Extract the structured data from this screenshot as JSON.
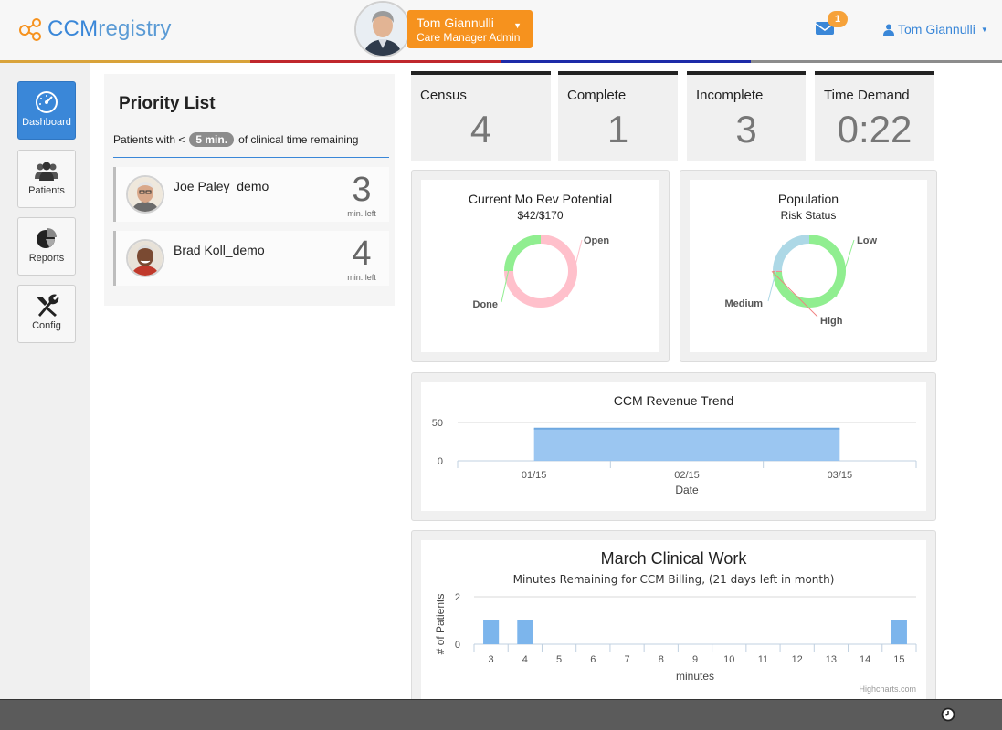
{
  "header": {
    "brand": {
      "prefix": "CCM",
      "suffix": "registry"
    },
    "user_badge": {
      "name": "Tom Giannulli",
      "role": "Care Manager Admin"
    },
    "mail_count": "1",
    "user_menu": "Tom Giannulli"
  },
  "stripe_colors": [
    "#d9a33a",
    "#c0282d",
    "#1d2aa8",
    "#8c8c8c"
  ],
  "sidebar": {
    "items": [
      {
        "label": "Dashboard",
        "icon": "dashboard-icon",
        "active": true
      },
      {
        "label": "Patients",
        "icon": "patients-icon"
      },
      {
        "label": "Reports",
        "icon": "pie-icon"
      },
      {
        "label": "Config",
        "icon": "wrench-icon"
      }
    ]
  },
  "priority": {
    "title": "Priority List",
    "sub_before": "Patients with <",
    "pill": "5 min.",
    "sub_after": "of clinical time remaining",
    "patients": [
      {
        "name": "Joe Paley_demo",
        "minutes": "3",
        "unit": "min. left"
      },
      {
        "name": "Brad Koll_demo",
        "minutes": "4",
        "unit": "min. left"
      }
    ]
  },
  "stats": [
    {
      "label": "Census",
      "value": "4"
    },
    {
      "label": "Complete",
      "value": "1"
    },
    {
      "label": "Incomplete",
      "value": "3"
    },
    {
      "label": "Time Demand",
      "value": "0:22"
    }
  ],
  "revenue_potential": {
    "title": "Current Mo Rev Potential",
    "subtitle": "$42/$170",
    "slices": [
      {
        "name": "Open",
        "value": 75,
        "color": "#ffc0cb"
      },
      {
        "name": "Done",
        "value": 25,
        "color": "#90ee90"
      }
    ]
  },
  "population": {
    "title": "Population",
    "subtitle": "Risk Status",
    "slices": [
      {
        "name": "Low",
        "value": 3,
        "color": "#90ee90"
      },
      {
        "name": "High",
        "value": 0.02,
        "color": "#f08080"
      },
      {
        "name": "Medium",
        "value": 1,
        "color": "#add8e6"
      }
    ]
  },
  "chart_data": [
    {
      "type": "area",
      "title": "CCM Revenue Trend",
      "xlabel": "Date",
      "ylabel": "",
      "x_ticks": [
        "01/15",
        "02/15",
        "03/15"
      ],
      "x": [
        0.5,
        2.5
      ],
      "values": [
        42,
        42
      ],
      "ylim": [
        0,
        50
      ],
      "y_ticks": [
        0,
        50
      ],
      "color": "#90c0f0"
    },
    {
      "type": "bar",
      "title": "March Clinical Work",
      "subtitle": "Minutes Remaining for CCM Billing, (21 days left in month)",
      "xlabel": "minutes",
      "ylabel": "# of Patients",
      "categories": [
        "3",
        "4",
        "5",
        "6",
        "7",
        "8",
        "9",
        "10",
        "11",
        "12",
        "13",
        "14",
        "15"
      ],
      "values": [
        1,
        1,
        0,
        0,
        0,
        0,
        0,
        0,
        0,
        0,
        0,
        0,
        1
      ],
      "ylim": [
        0,
        2
      ],
      "y_ticks": [
        0,
        2
      ],
      "color": "#7cb5ec",
      "credits": "Highcharts.com"
    }
  ]
}
